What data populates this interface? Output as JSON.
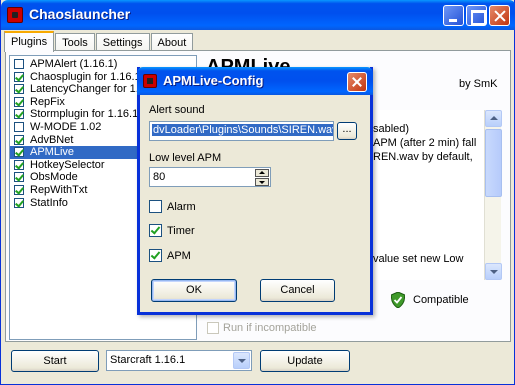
{
  "window": {
    "title": "Chaoslauncher"
  },
  "tabs": [
    {
      "label": "Plugins",
      "active": true
    },
    {
      "label": "Tools"
    },
    {
      "label": "Settings"
    },
    {
      "label": "About"
    }
  ],
  "plugins": [
    {
      "label": "APMAlert (1.16.1)",
      "checked": false
    },
    {
      "label": "Chaosplugin for 1.16.1",
      "checked": true
    },
    {
      "label": "LatencyChanger for 1.16.1",
      "checked": true
    },
    {
      "label": "RepFix",
      "checked": true
    },
    {
      "label": "Stormplugin for 1.16.1",
      "checked": true
    },
    {
      "label": "W-MODE 1.02",
      "checked": false
    },
    {
      "label": "AdvBNet",
      "checked": true
    },
    {
      "label": "APMLive",
      "checked": true,
      "selected": true
    },
    {
      "label": "HotkeySelector",
      "checked": true
    },
    {
      "label": "ObsMode",
      "checked": true
    },
    {
      "label": "RepWithTxt",
      "checked": true
    },
    {
      "label": "StatInfo",
      "checked": true
    }
  ],
  "detail": {
    "title": "APMLive",
    "author": "by SmK",
    "desc_lines": [
      "sabled)",
      "APM (after 2 min) fall",
      "REN.wav by default,",
      "value set new Low"
    ],
    "compatible_label": "Compatible",
    "run_incompatible_label": "Run if incompatible"
  },
  "bottom": {
    "start_label": "Start",
    "version_selected": "Starcraft 1.16.1",
    "update_label": "Update"
  },
  "dialog": {
    "title": "APMLive-Config",
    "alert_sound_label": "Alert sound",
    "alert_sound_value": "dvLoader\\Plugins\\Sounds\\SIREN.wav",
    "browse_label": "...",
    "low_apm_label": "Low level APM",
    "low_apm_value": "80",
    "alarm_label": "Alarm",
    "alarm_checked": false,
    "timer_label": "Timer",
    "timer_checked": true,
    "apm_label": "APM",
    "apm_checked": true,
    "ok_label": "OK",
    "cancel_label": "Cancel"
  },
  "colors": {
    "xp_blue": "#0053ee",
    "selection": "#316ac5",
    "face": "#ece9d8"
  },
  "icons": {
    "app": "chaoslauncher-icon",
    "compatible": "green-shield-icon"
  }
}
